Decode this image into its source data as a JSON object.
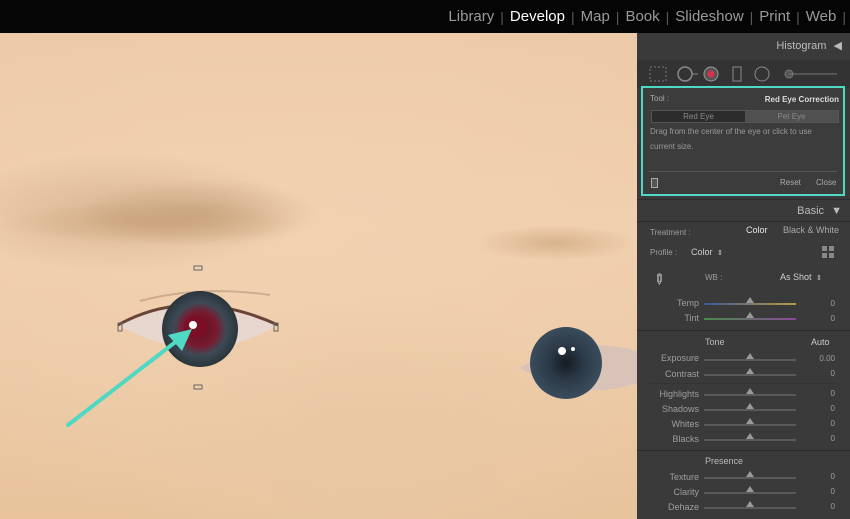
{
  "nav": {
    "modules": [
      "Library",
      "Develop",
      "Map",
      "Book",
      "Slideshow",
      "Print",
      "Web"
    ],
    "active": "Develop",
    "separator": "|"
  },
  "panel": {
    "histogram_label": "Histogram",
    "tool": {
      "label": "Tool :",
      "name": "Red Eye Correction",
      "modes": [
        "Red Eye",
        "Pet Eye"
      ],
      "hint_line1": "Drag from the center of the eye or click to use",
      "hint_line2": "current size.",
      "reset": "Reset",
      "close": "Close"
    },
    "basic": {
      "title": "Basic",
      "treatment_label": "Treatment :",
      "treatment_color": "Color",
      "treatment_bw": "Black & White",
      "profile_label": "Profile :",
      "profile_value": "Color",
      "wb_label": "WB :",
      "wb_value": "As Shot",
      "temp_label": "Temp",
      "temp_value": "0",
      "tint_label": "Tint",
      "tint_value": "0",
      "tone_title": "Tone",
      "auto": "Auto",
      "exposure_label": "Exposure",
      "exposure_value": "0.00",
      "contrast_label": "Contrast",
      "contrast_value": "0",
      "highlights_label": "Highlights",
      "highlights_value": "0",
      "shadows_label": "Shadows",
      "shadows_value": "0",
      "whites_label": "Whites",
      "whites_value": "0",
      "blacks_label": "Blacks",
      "blacks_value": "0",
      "presence_title": "Presence",
      "texture_label": "Texture",
      "texture_value": "0",
      "clarity_label": "Clarity",
      "clarity_value": "0",
      "dehaze_label": "Dehaze",
      "dehaze_value": "0"
    }
  },
  "colors": {
    "accent": "#4fd8c4",
    "panel_bg": "#3a3a3a",
    "topbar_bg": "#050505",
    "skin": "#f0cfae"
  }
}
